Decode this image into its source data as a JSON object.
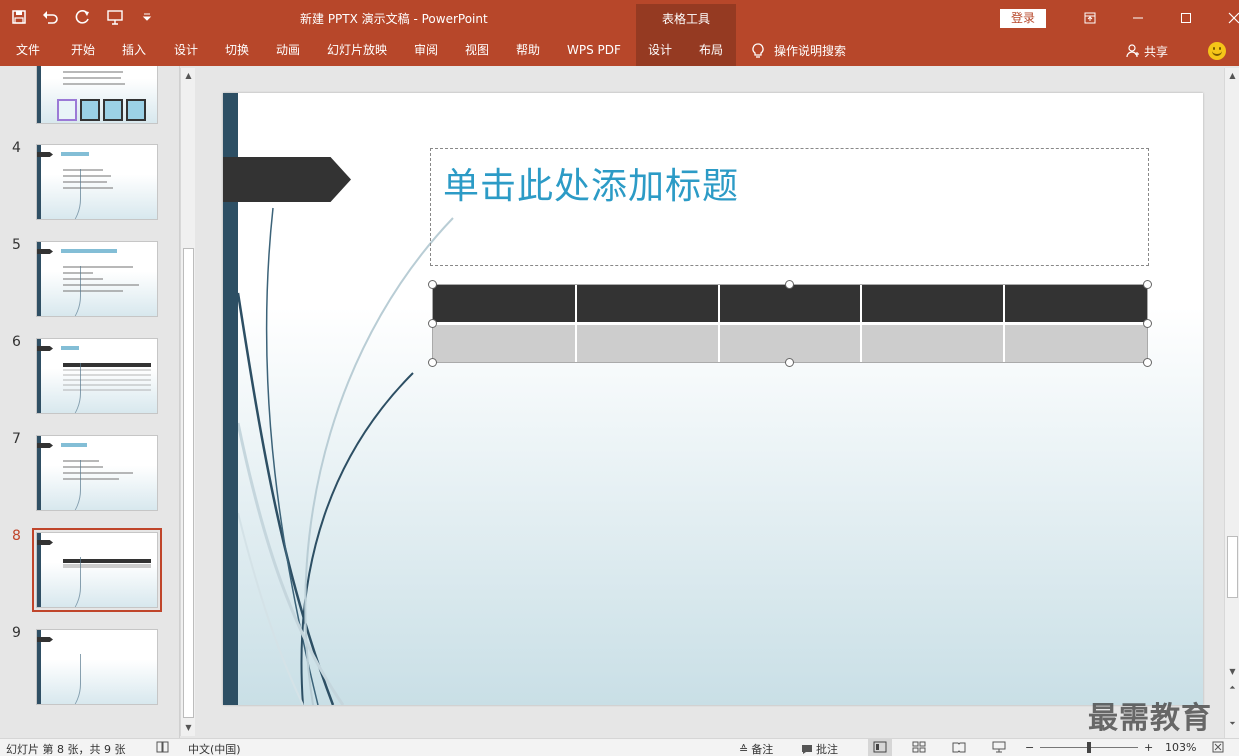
{
  "titlebar": {
    "doc_title": "新建 PPTX 演示文稿  -  PowerPoint",
    "context_group": "表格工具",
    "login": "登录"
  },
  "ribbon": {
    "tabs": [
      "文件",
      "开始",
      "插入",
      "设计",
      "切换",
      "动画",
      "幻灯片放映",
      "审阅",
      "视图",
      "帮助",
      "WPS PDF",
      "设计",
      "布局"
    ],
    "tell_me": "操作说明搜索",
    "share": "共享"
  },
  "thumbnails": {
    "numbers": [
      "4",
      "5",
      "6",
      "7",
      "8",
      "9"
    ],
    "selected": "8"
  },
  "slide": {
    "title_placeholder": "单击此处添加标题",
    "table": {
      "columns": 5,
      "rows": 2
    }
  },
  "statusbar": {
    "slide_info": "幻灯片 第 8 张，共 9 张",
    "language": "中文(中国)",
    "notes": "备注",
    "comments": "批注",
    "zoom_minus": "−",
    "zoom_plus": "+",
    "zoom": "103%"
  },
  "watermark": "最需教育",
  "colors": {
    "ribbon": "#b7472a",
    "context_tab": "#953a22",
    "title_text": "#2c9bc6",
    "selection": "#c0452b"
  }
}
